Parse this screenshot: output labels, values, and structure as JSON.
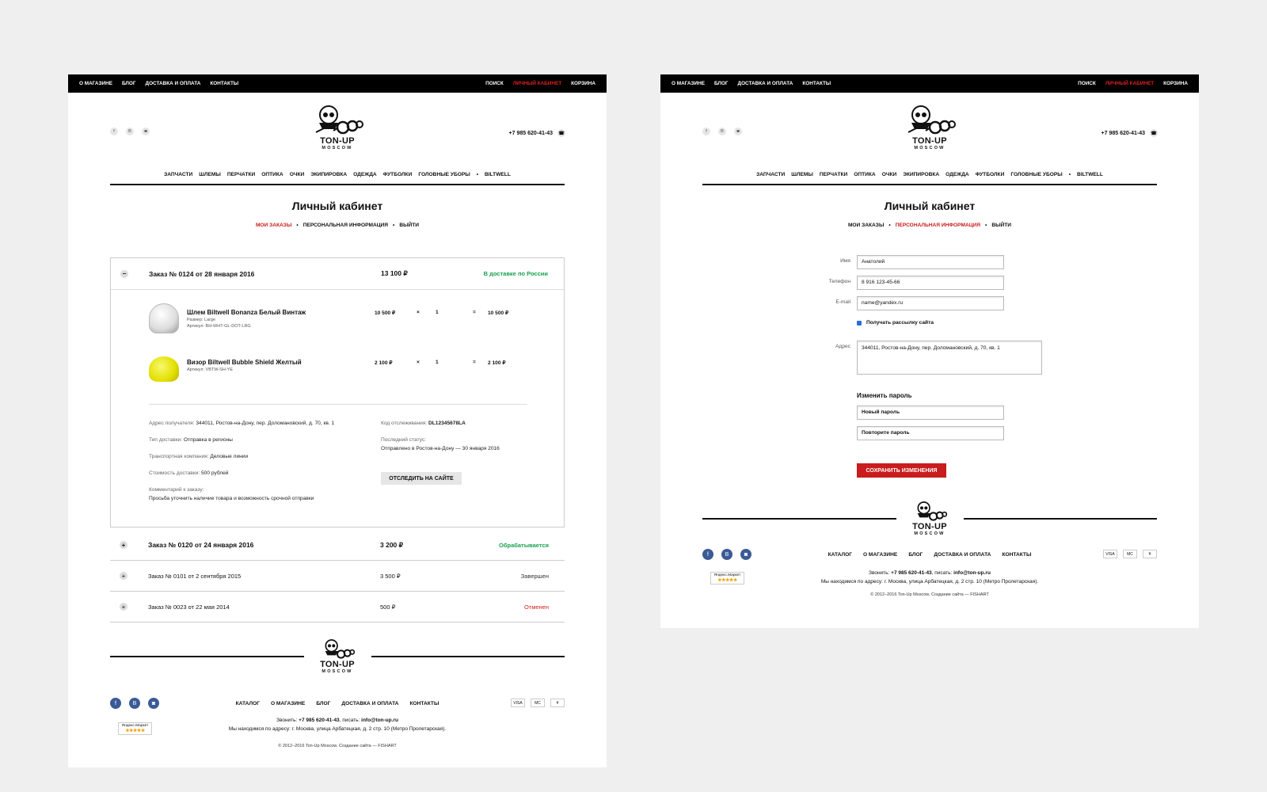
{
  "nav": {
    "about": "О МАГАЗИНЕ",
    "blog": "БЛОГ",
    "delivery": "ДОСТАВКА И ОПЛАТА",
    "contacts": "КОНТАКТЫ",
    "search": "ПОИСК",
    "account": "ЛИЧНЫЙ КАБИНЕТ",
    "cart": "КОРЗИНА"
  },
  "social": {
    "fb": "f",
    "vk": "В",
    "ig": "◙"
  },
  "phone": "+7 985 620-41-43",
  "logo": {
    "title": "TON-UP",
    "sub": "MOSCOW"
  },
  "categories": [
    "ЗАПЧАСТИ",
    "ШЛЕМЫ",
    "ПЕРЧАТКИ",
    "ОПТИКА",
    "ОЧКИ",
    "ЭКИПИРОВКА",
    "ОДЕЖДА",
    "ФУТБОЛКИ",
    "ГОЛОВНЫЕ УБОРЫ",
    "BILTWELL"
  ],
  "page_title": "Личный кабинет",
  "account_tabs": {
    "orders": "МОИ ЗАКАЗЫ",
    "personal": "ПЕРСОНАЛЬНАЯ ИНФОРМАЦИЯ",
    "logout": "ВЫЙТИ"
  },
  "orders": [
    {
      "title": "Заказ № 0124 от 28 января 2016",
      "sum": "13 100 ₽",
      "status": "В доставке по России",
      "toggle": "−"
    },
    {
      "title": "Заказ № 0120 от 24 января 2016",
      "sum": "3 200 ₽",
      "status": "Обрабатывается",
      "toggle": "+"
    },
    {
      "title": "Заказ № 0101 от 2 сентября 2015",
      "sum": "3 500 ₽",
      "status": "Завершен",
      "toggle": "+"
    },
    {
      "title": "Заказ № 0023 от 22 мая 2014",
      "sum": "500 ₽",
      "status": "Отменен",
      "toggle": "+"
    }
  ],
  "items": [
    {
      "name": "Шлем Biltwell Bonanza Белый Винтаж",
      "size": "Размер: Large",
      "sku": "Артикул: BH-WHT-GL-DOT-LRG",
      "price": "10 500 ₽",
      "times": "×",
      "qty": "1",
      "eq": "=",
      "total": "10 500 ₽"
    },
    {
      "name": "Визор Biltwell Bubble Shield Желтый",
      "sku": "Артикул: VBTW-SH-YE",
      "price": "2 100 ₽",
      "times": "×",
      "qty": "1",
      "eq": "=",
      "total": "2 100 ₽"
    }
  ],
  "details": {
    "address_k": "Адрес получателя:",
    "address_v": "344011, Ростов-на-Дону, пер. Доломановский, д. 70, кв. 1",
    "type_k": "Тип доставки:",
    "type_v": "Отправка в регионы",
    "company_k": "Транспортная компания:",
    "company_v": "Деловые линии",
    "cost_k": "Стоимость доставки:",
    "cost_v": "500 рублей",
    "comment_k": "Комментарий к заказу:",
    "comment_v": "Просьба уточнить наличие товара и возможность срочной отправки",
    "tracking_k": "Код отслеживания:",
    "tracking_v": "DL12345678LA",
    "last_k": "Последний статус:",
    "last_v": "Отправлено в Ростов-на-Дону — 30 января 2016",
    "track_btn": "ОТСЛЕДИТЬ НА САЙТЕ"
  },
  "footer": {
    "menu": [
      "КАТАЛОГ",
      "О МАГАЗИНЕ",
      "БЛОГ",
      "ДОСТАВКА И ОПЛАТА",
      "КОНТАКТЫ"
    ],
    "call": "Звонить: ",
    "call_phone": "+7 985 620-41-43",
    "write": ", писать: ",
    "email": "info@ton-up.ru",
    "address": "Мы находимся по адресу: г. Москва, улица Арбатецкая, д. 2 стр. 10 (Метро Пролетарская).",
    "copyright": "© 2012–2016 Ton-Up Moscow. Создание сайта — FISHART",
    "pays": [
      "VISA",
      "MC",
      "¥"
    ],
    "market": "Яндекс.Маркет",
    "stars": "★★★★★"
  },
  "form": {
    "name_label": "Имя",
    "name_value": "Анатолий",
    "phone_label": "Телефон",
    "phone_value": "8 916 123-45-66",
    "email_label": "E-mail",
    "email_value": "name@yandex.ru",
    "newsletter": "Получать рассылку сайта",
    "address_label": "Адрес",
    "address_value": "344011, Ростов-на-Дону, пер. Доломановский, д. 70, кв. 1",
    "change_pw": "Изменить пароль",
    "new_pw": "Новый пароль",
    "repeat_pw": "Повторите пароль",
    "save": "СОХРАНИТЬ ИЗМЕНЕНИЯ"
  },
  "colors": {
    "accent": "#c91c1c",
    "green": "#18a050",
    "topbar": "#000000"
  }
}
